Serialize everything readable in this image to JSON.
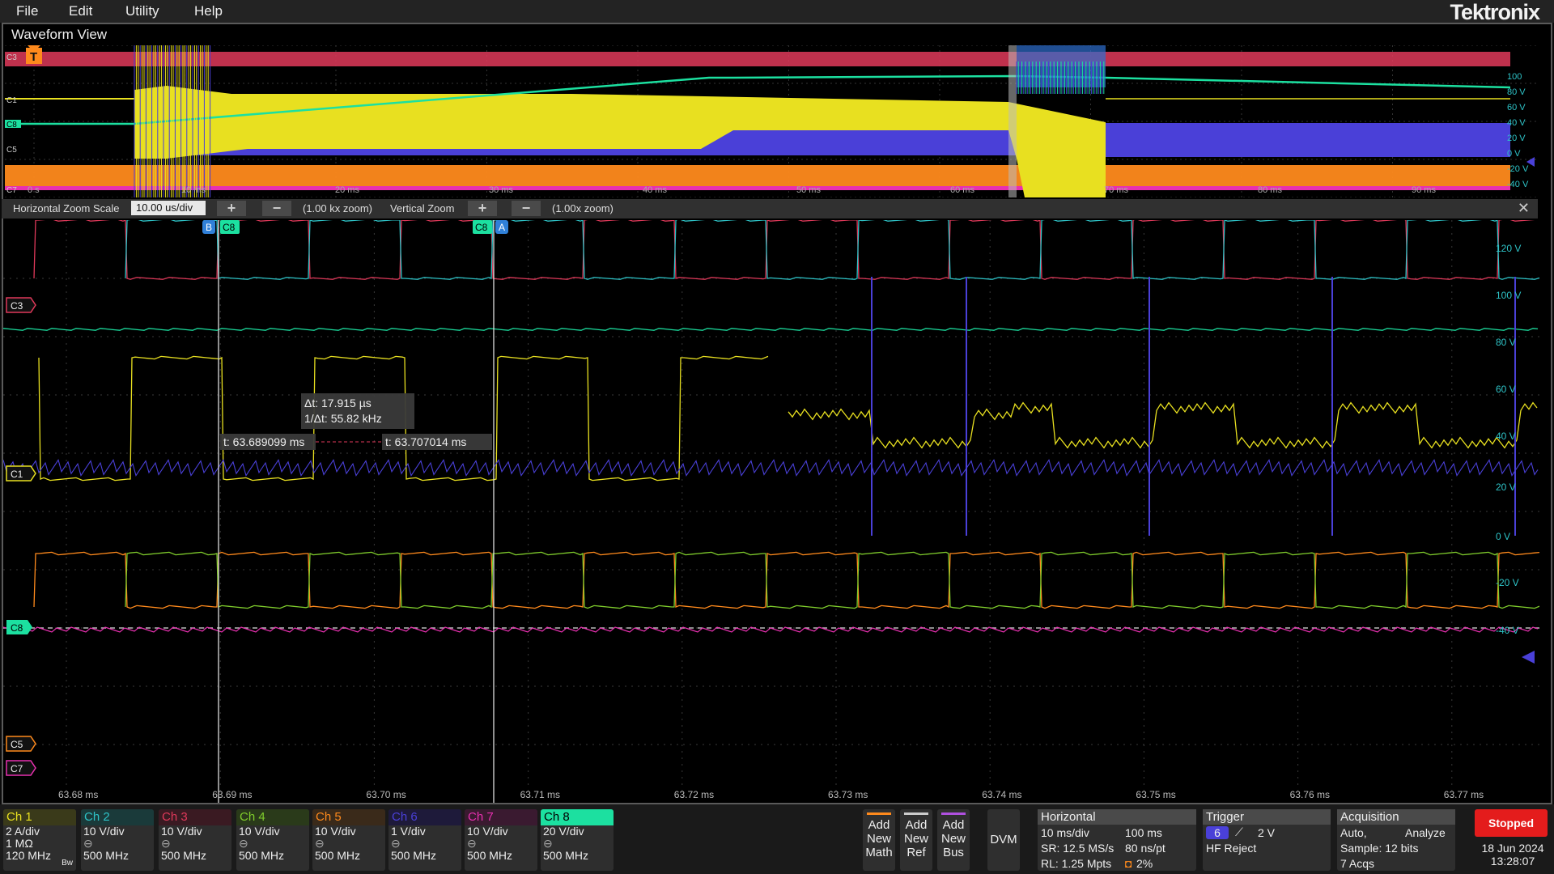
{
  "menu": {
    "items": [
      "File",
      "Edit",
      "Utility",
      "Help"
    ],
    "brand": "Tektronix"
  },
  "waveform_view": {
    "title": "Waveform View"
  },
  "colors": {
    "c1": "#e8e020",
    "c2": "#2ec4c8",
    "c3": "#e0395a",
    "c4": "#7fcc2c",
    "c5": "#ff8a1c",
    "c6": "#4a40d8",
    "c7": "#e830b0",
    "c8": "#1ce0a0"
  },
  "overview": {
    "channels": [
      "C3",
      "C1",
      "C8",
      "C5",
      "C7"
    ],
    "trigger_label": "T",
    "time_labels": [
      "0 s",
      "10 ms",
      "20 ms",
      "30 ms",
      "40 ms",
      "50 ms",
      "60 ms",
      "70 ms",
      "80 ms",
      "90 ms"
    ],
    "volt_labels": [
      "100",
      "80 V",
      "60 V",
      "40 V",
      "20 V",
      "0 V",
      "-20 V",
      "-40 V"
    ]
  },
  "zoom": {
    "horizontal_label": "Horizontal Zoom Scale",
    "horizontal_value": "10.00 us/div",
    "plus": "+",
    "minus": "−",
    "horizontal_zoom": "(1.00 kx zoom)",
    "vertical_label": "Vertical Zoom",
    "vertical_zoom": "(1.00x zoom)",
    "close": "✕"
  },
  "main": {
    "cursor_b_label": "B",
    "cursor_a_label": "A",
    "cursor_src": "C8",
    "delta_t": "Δt: 17.915 µs",
    "inv_delta_t": "1/Δt: 55.82 kHz",
    "t_left": "t: 63.689099 ms",
    "t_right": "t: 63.707014 ms",
    "channel_tags": [
      "C3",
      "C1",
      "C8",
      "C5",
      "C7"
    ],
    "time_labels": [
      "63.68 ms",
      "63.69 ms",
      "63.70 ms",
      "63.71 ms",
      "63.72 ms",
      "63.73 ms",
      "63.74 ms",
      "63.75 ms",
      "63.76 ms",
      "63.77 ms"
    ],
    "volt_labels": [
      "120 V",
      "100 V",
      "80 V",
      "60 V",
      "40 V",
      "20 V",
      "0 V",
      "-20 V",
      "-40 V"
    ]
  },
  "channels": [
    {
      "name": "Ch 1",
      "l1": "2 A/div",
      "l2": "1 MΩ",
      "l3": "120 MHz",
      "bw": "Bw"
    },
    {
      "name": "Ch 2",
      "l1": "10 V/div",
      "l2": "",
      "l3": "500 MHz",
      "bw": ""
    },
    {
      "name": "Ch 3",
      "l1": "10 V/div",
      "l2": "",
      "l3": "500 MHz",
      "bw": ""
    },
    {
      "name": "Ch 4",
      "l1": "10 V/div",
      "l2": "",
      "l3": "500 MHz",
      "bw": ""
    },
    {
      "name": "Ch 5",
      "l1": "10 V/div",
      "l2": "",
      "l3": "500 MHz",
      "bw": ""
    },
    {
      "name": "Ch 6",
      "l1": "1 V/div",
      "l2": "",
      "l3": "500 MHz",
      "bw": ""
    },
    {
      "name": "Ch 7",
      "l1": "10 V/div",
      "l2": "",
      "l3": "500 MHz",
      "bw": ""
    },
    {
      "name": "Ch 8",
      "l1": "20 V/div",
      "l2": "",
      "l3": "500 MHz",
      "bw": ""
    }
  ],
  "actions": {
    "math": [
      "Add",
      "New",
      "Math"
    ],
    "ref": [
      "Add",
      "New",
      "Ref"
    ],
    "bus": [
      "Add",
      "New",
      "Bus"
    ],
    "dvm": "DVM"
  },
  "horizontal": {
    "title": "Horizontal",
    "scale": "10 ms/div",
    "length": "100 ms",
    "sr": "SR: 12.5 MS/s",
    "res": "80 ns/pt",
    "rl": "RL: 1.25 Mpts",
    "pos": "2%"
  },
  "trigger": {
    "title": "Trigger",
    "source": "6",
    "level": "2 V",
    "mode": "HF Reject"
  },
  "acquisition": {
    "title": "Acquisition",
    "mode": "Auto,",
    "analyze": "Analyze",
    "sample": "Sample: 12 bits",
    "acqs": "7 Acqs"
  },
  "status": {
    "run": "Stopped",
    "date": "18 Jun 2024",
    "time": "13:28:07"
  }
}
